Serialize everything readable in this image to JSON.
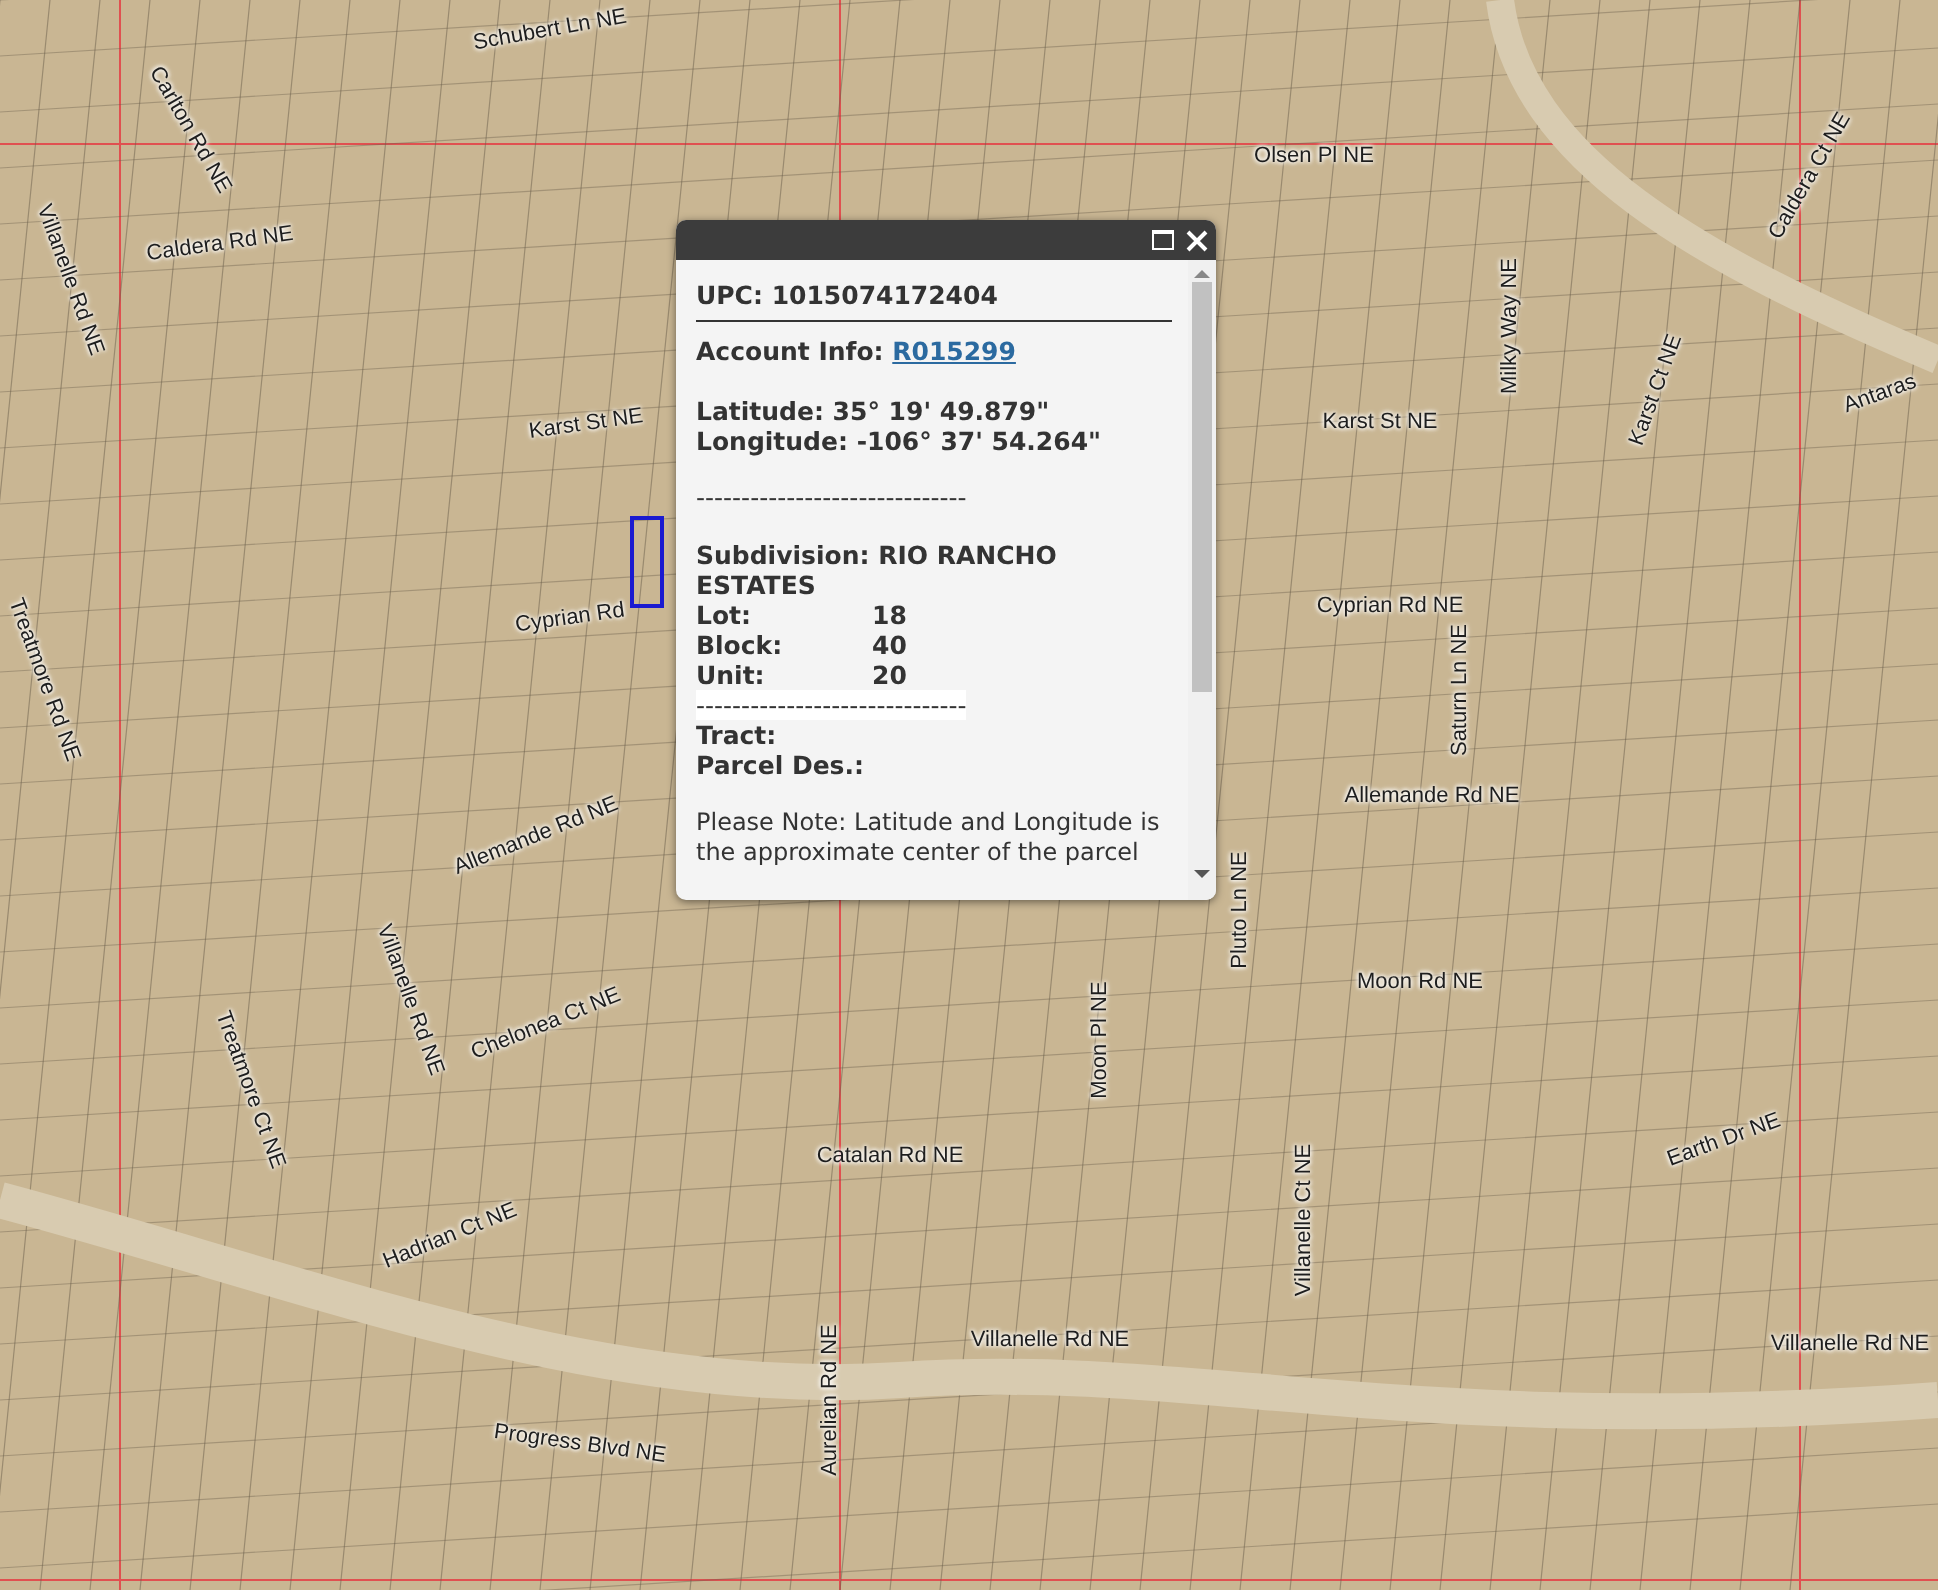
{
  "map": {
    "street_labels": [
      "Schubert Ln NE",
      "Olsen Pl NE",
      "Caldera Rd NE",
      "Carlton Rd NE",
      "Villanelle Rd NE",
      "Karst St NE",
      "Cyprian Rd",
      "Karst St NE",
      "Milky Way NE",
      "Karst Ct NE",
      "Caldera Ct NE",
      "Antaras",
      "Cyprian Rd NE",
      "Saturn Ln NE",
      "Allemande Rd NE",
      "Allemande Rd NE",
      "Moon Rd NE",
      "Pluto Ln NE",
      "Moon Pl NE",
      "Chelonea Ct NE",
      "Villanelle Rd NE",
      "Treatmore Rd NE",
      "Treatmore Ct NE",
      "Catalan Rd NE",
      "Hadrian Ct NE",
      "Villanelle Ct NE",
      "Earth Dr NE",
      "Villanelle Rd NE",
      "Villanelle Rd NE",
      "Progress Blvd NE",
      "Aurelian Rd NE"
    ]
  },
  "popup": {
    "upc": "UPC: 1015074172404",
    "account_label": "Account Info:",
    "account_link": "R015299",
    "latitude": "Latitude: 35° 19' 49.879\"",
    "longitude": "Longitude: -106° 37' 54.264\"",
    "separator": "------------------------------",
    "subdivision": "Subdivision: RIO RANCHO ESTATES",
    "fields": [
      {
        "label": "Lot:",
        "value": "18"
      },
      {
        "label": "Block:",
        "value": "40"
      },
      {
        "label": "Unit:",
        "value": "20"
      }
    ],
    "separator_2": "------------------------------",
    "tract": "Tract:",
    "parcel": "Parcel Des.:",
    "note": "Please Note: Latitude and Longitude is the approximate center of the parcel"
  }
}
